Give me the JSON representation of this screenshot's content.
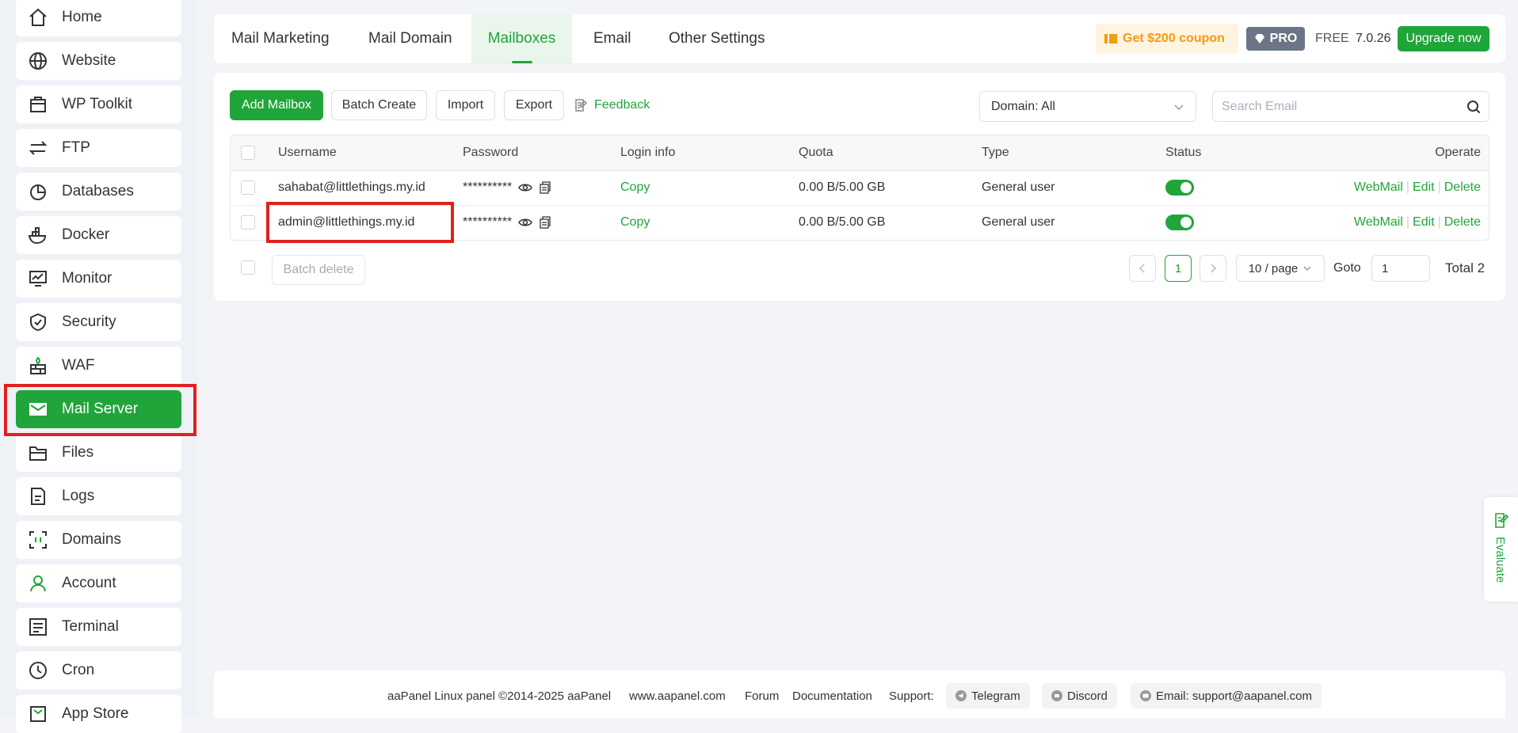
{
  "sidebar": {
    "items": [
      {
        "label": "Home",
        "icon": "home-icon"
      },
      {
        "label": "Website",
        "icon": "globe-icon"
      },
      {
        "label": "WP Toolkit",
        "icon": "toolkit-icon"
      },
      {
        "label": "FTP",
        "icon": "transfer-icon"
      },
      {
        "label": "Databases",
        "icon": "database-icon"
      },
      {
        "label": "Docker",
        "icon": "docker-icon"
      },
      {
        "label": "Monitor",
        "icon": "monitor-icon"
      },
      {
        "label": "Security",
        "icon": "shield-icon"
      },
      {
        "label": "WAF",
        "icon": "firewall-icon"
      },
      {
        "label": "Mail Server",
        "icon": "mail-icon",
        "active": true
      },
      {
        "label": "Files",
        "icon": "folder-icon"
      },
      {
        "label": "Logs",
        "icon": "log-icon"
      },
      {
        "label": "Domains",
        "icon": "domains-icon"
      },
      {
        "label": "Account",
        "icon": "user-icon"
      },
      {
        "label": "Terminal",
        "icon": "terminal-icon"
      },
      {
        "label": "Cron",
        "icon": "clock-icon"
      },
      {
        "label": "App Store",
        "icon": "store-icon"
      }
    ]
  },
  "tabs": [
    "Mail Marketing",
    "Mail Domain",
    "Mailboxes",
    "Email",
    "Other Settings"
  ],
  "active_tab": "Mailboxes",
  "header": {
    "coupon": "Get $200 coupon",
    "pro": "PRO",
    "free": "FREE",
    "version": "7.0.26",
    "upgrade": "Upgrade now"
  },
  "toolbar": {
    "add": "Add Mailbox",
    "batch_create": "Batch Create",
    "import": "Import",
    "export": "Export",
    "feedback": "Feedback",
    "domain_select": "Domain: All",
    "search_placeholder": "Search Email"
  },
  "table": {
    "headers": {
      "username": "Username",
      "password": "Password",
      "login": "Login info",
      "quota": "Quota",
      "type": "Type",
      "status": "Status",
      "operate": "Operate"
    },
    "rows": [
      {
        "username": "sahabat@littlethings.my.id",
        "password": "**********",
        "login": "Copy",
        "quota": "0.00 B/5.00 GB",
        "type": "General user",
        "status": true,
        "webmail": "WebMail",
        "edit": "Edit",
        "delete": "Delete"
      },
      {
        "username": "admin@littlethings.my.id",
        "password": "**********",
        "login": "Copy",
        "quota": "0.00 B/5.00 GB",
        "type": "General user",
        "status": true,
        "webmail": "WebMail",
        "edit": "Edit",
        "delete": "Delete"
      }
    ]
  },
  "bottom": {
    "batch_delete": "Batch delete",
    "page": "1",
    "per_page": "10 / page",
    "goto_label": "Goto",
    "goto_value": "1",
    "total": "Total 2"
  },
  "footer": {
    "copyright": "aaPanel Linux panel ©2014-2025 aaPanel",
    "site": "www.aapanel.com",
    "forum": "Forum",
    "docs": "Documentation",
    "support": "Support:",
    "telegram": "Telegram",
    "discord": "Discord",
    "email": "Email: support@aapanel.com"
  },
  "evaluate": "Evaluate",
  "colors": {
    "accent": "#20a53a",
    "highlight": "#e02020",
    "coupon": "#f39b13"
  }
}
